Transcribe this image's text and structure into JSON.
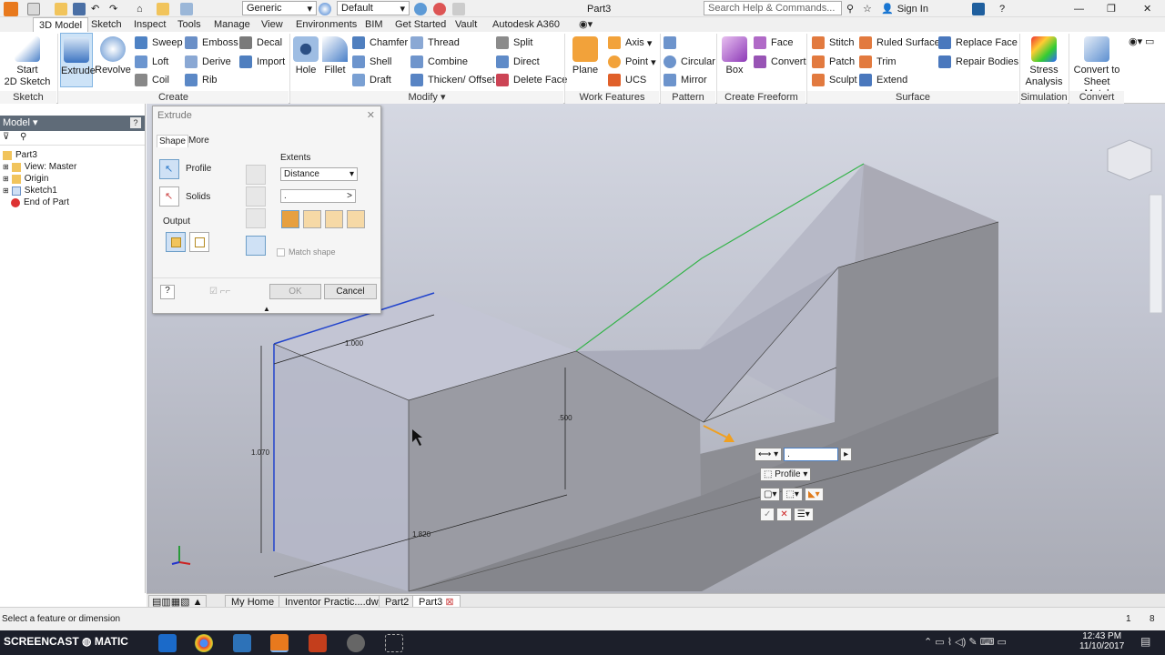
{
  "titlebar": {
    "document_title": "Part3",
    "appearance": "Generic",
    "material": "Default",
    "search_placeholder": "Search Help & Commands...",
    "sign_in": "Sign In"
  },
  "tabs": [
    "3D Model",
    "Sketch",
    "Inspect",
    "Tools",
    "Manage",
    "View",
    "Environments",
    "BIM",
    "Get Started",
    "Vault",
    "Autodesk A360"
  ],
  "ribbon": {
    "sketch": {
      "start": "Start",
      "sketch2d": "2D Sketch",
      "group": "Sketch"
    },
    "create": {
      "extrude": "Extrude",
      "revolve": "Revolve",
      "sweep": "Sweep",
      "loft": "Loft",
      "coil": "Coil",
      "emboss": "Emboss",
      "derive": "Derive",
      "rib": "Rib",
      "decal": "Decal",
      "import": "Import",
      "group": "Create"
    },
    "modify": {
      "hole": "Hole",
      "fillet": "Fillet",
      "chamfer": "Chamfer",
      "shell": "Shell",
      "draft": "Draft",
      "thread": "Thread",
      "combine": "Combine",
      "thicken": "Thicken/ Offset",
      "split": "Split",
      "direct": "Direct",
      "delete_face": "Delete Face",
      "group": "Modify"
    },
    "work": {
      "plane": "Plane",
      "axis": "Axis",
      "point": "Point",
      "ucs": "UCS",
      "group": "Work Features"
    },
    "pattern": {
      "circular": "Circular",
      "mirror": "Mirror",
      "group": "Pattern"
    },
    "freeform": {
      "box": "Box",
      "face": "Face",
      "convert": "Convert",
      "group": "Create Freeform"
    },
    "surface": {
      "stitch": "Stitch",
      "patch": "Patch",
      "sculpt": "Sculpt",
      "ruled": "Ruled Surface",
      "trim": "Trim",
      "extend": "Extend",
      "replace": "Replace Face",
      "repair": "Repair Bodies",
      "group": "Surface"
    },
    "simulation": {
      "stress1": "Stress",
      "stress2": "Analysis",
      "group": "Simulation"
    },
    "convert": {
      "sheet1": "Convert to",
      "sheet2": "Sheet Metal",
      "group": "Convert"
    }
  },
  "browser": {
    "title": "Model",
    "items": [
      "Part3",
      "View: Master",
      "Origin",
      "Sketch1",
      "End of Part"
    ]
  },
  "dialog": {
    "title": "Extrude",
    "tab_shape": "Shape",
    "tab_more": "More",
    "profile": "Profile",
    "solids": "Solids",
    "output": "Output",
    "extents": "Extents",
    "extent_type": "Distance",
    "distance_value": ".",
    "match_shape": "Match shape",
    "ok": "OK",
    "cancel": "Cancel"
  },
  "dimensions": {
    "width": "1.000",
    "height": "1.070",
    "depth_mid": ".500",
    "length": "1.820"
  },
  "minitoolbar": {
    "value": ".",
    "profile": "Profile"
  },
  "doc_tabs": [
    "My Home",
    "Inventor Practic....dwg",
    "Part2",
    "Part3"
  ],
  "status": {
    "message": "Select a feature or dimension",
    "count1": "1",
    "count2": "8"
  },
  "taskbar": {
    "watermark": "SCREENCAST",
    "watermark2": "MATIC",
    "time": "12:43 PM",
    "date": "11/10/2017"
  },
  "colors": {
    "accent": "#2a77c9",
    "selection_blue": "#2244cc",
    "edge_green": "#35b34a",
    "arrow_orange": "#f0a020"
  }
}
